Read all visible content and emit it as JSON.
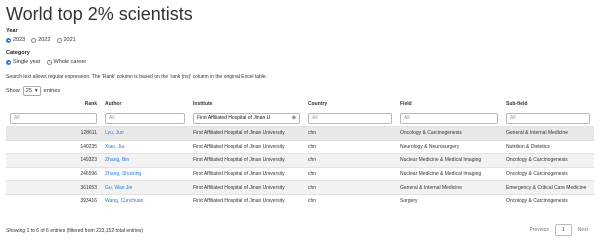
{
  "title": "World top 2% scientists",
  "year": {
    "label": "Year",
    "options": [
      "2023",
      "2022",
      "2021"
    ],
    "selected": "2023"
  },
  "category": {
    "label": "Category",
    "options": [
      "Single year",
      "Whole career"
    ],
    "selected": "Single year"
  },
  "note": "Search text allows regular expression. The 'Rank' column is based on the 'rank (ns)' column in the original Excel table.",
  "show": {
    "prefix": "Show",
    "value": "25",
    "suffix": "entries"
  },
  "columns": [
    "Rank",
    "Author",
    "Institute",
    "Country",
    "Field",
    "Sub-field"
  ],
  "filters": [
    {
      "placeholder": "All",
      "value": ""
    },
    {
      "placeholder": "All",
      "value": ""
    },
    {
      "placeholder": "All",
      "value": "First Affiliated Hospital of Jinan U"
    },
    {
      "placeholder": "All",
      "value": ""
    },
    {
      "placeholder": "All",
      "value": ""
    },
    {
      "placeholder": "All",
      "value": ""
    }
  ],
  "rows": [
    {
      "rank": "128611",
      "author": "Lyu, Jun",
      "institute": "First Affiliated Hospital of Jinan University",
      "country": "chn",
      "field": "Oncology & Carcinogenesis",
      "subfield": "General & Internal Medicine"
    },
    {
      "rank": "140235",
      "author": "Xiao, Jia",
      "institute": "First Affiliated Hospital of Jinan University",
      "country": "chn",
      "field": "Neurology & Neurosurgery",
      "subfield": "Nutrition & Dietetics"
    },
    {
      "rank": "149323",
      "author": "Zhang, Bin",
      "institute": "First Affiliated Hospital of Jinan University",
      "country": "chn",
      "field": "Nuclear Medicine & Medical Imaging",
      "subfield": "Oncology & Carcinogenesis"
    },
    {
      "rank": "246596",
      "author": "Zhang, Shuixing",
      "institute": "First Affiliated Hospital of Jinan University",
      "country": "chn",
      "field": "Nuclear Medicine & Medical Imaging",
      "subfield": "Oncology & Carcinogenesis"
    },
    {
      "rank": "361653",
      "author": "Gu, Wan Jie",
      "institute": "First Affiliated Hospital of Jinan University",
      "country": "chn",
      "field": "General & Internal Medicine",
      "subfield": "Emergency & Critical Care Medicine"
    },
    {
      "rank": "393416",
      "author": "Wang, Cunchuan",
      "institute": "First Affiliated Hospital of Jinan University",
      "country": "chn",
      "field": "Surgery",
      "subfield": "Oncology & Carcinogenesis"
    }
  ],
  "footer": "Showing 1 to 6 of 6 entries (filtered from 223,152 total entries)",
  "pager": {
    "previous": "Previous",
    "current": "1",
    "next": "Next"
  },
  "colors": {
    "link": "#2a7ae2",
    "stripe": "#f2f2f2"
  }
}
